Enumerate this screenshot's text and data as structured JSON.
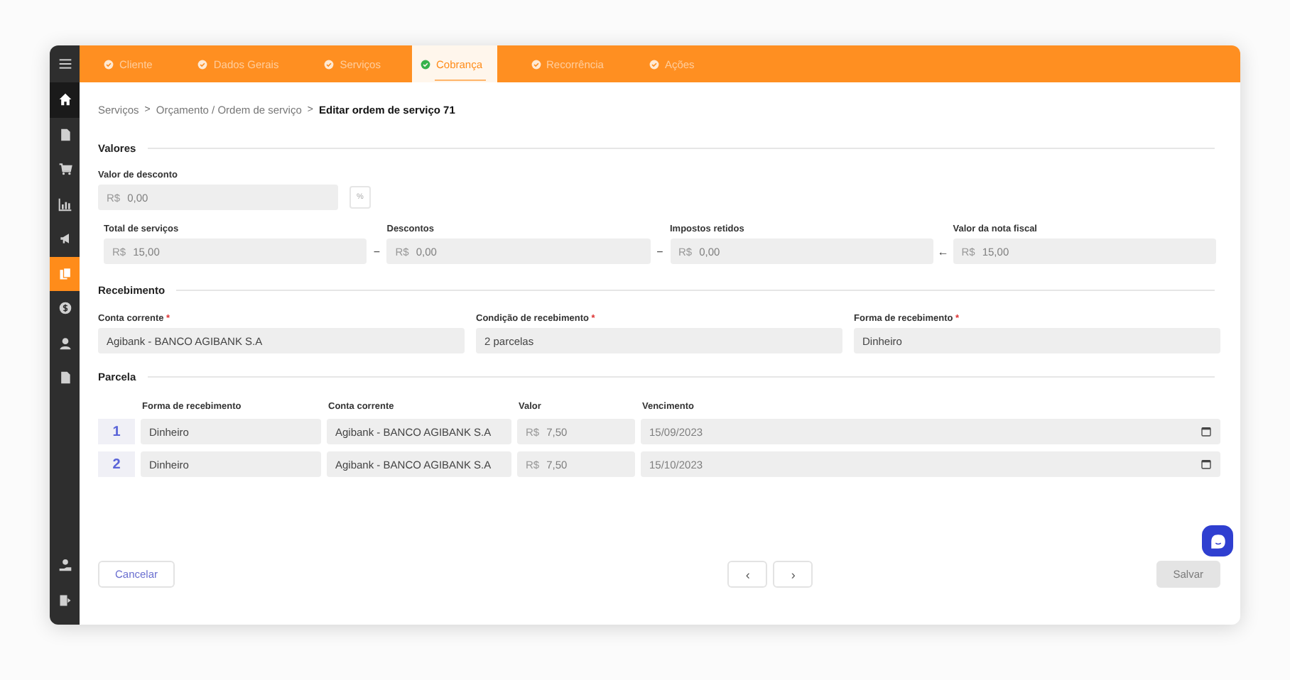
{
  "sidebar": {
    "items": [
      {
        "selected": false,
        "hovered": true
      },
      {
        "selected": false,
        "hovered": false
      },
      {
        "selected": false,
        "hovered": false
      },
      {
        "selected": false,
        "hovered": false
      },
      {
        "selected": false,
        "hovered": false
      },
      {
        "selected": true,
        "hovered": false
      },
      {
        "selected": false,
        "hovered": false
      },
      {
        "selected": false,
        "hovered": false
      },
      {
        "selected": false,
        "hovered": false
      }
    ],
    "bottom_items": [
      {
        "selected": false,
        "hovered": false
      },
      {
        "selected": false,
        "hovered": false
      }
    ]
  },
  "tabs": [
    {
      "label": "Cliente",
      "selected": false
    },
    {
      "label": "Dados Gerais",
      "selected": false
    },
    {
      "label": "Serviços",
      "selected": false
    },
    {
      "label": "Cobrança",
      "selected": true
    },
    {
      "label": "Recorrência",
      "selected": false
    },
    {
      "label": "Ações",
      "selected": false
    }
  ],
  "breadcrumb": [
    {
      "label": "Serviços",
      "current": false
    },
    {
      "label": "Orçamento / Ordem de serviço",
      "current": false
    },
    {
      "label": "Editar ordem de serviço 71",
      "current": true
    }
  ],
  "breadcrumb_separator": ">",
  "valores": {
    "title": "Valores",
    "discount": {
      "label": "Valor de desconto",
      "prefix": "R$",
      "value": "0,00",
      "toggle": "%"
    },
    "totals": [
      {
        "label": "Total de serviços",
        "prefix": "R$",
        "value": "15,00"
      },
      {
        "operator": "−",
        "label": "Descontos",
        "prefix": "R$",
        "value": "0,00"
      },
      {
        "operator": "−",
        "label": "Impostos retidos",
        "prefix": "R$",
        "value": "0,00"
      },
      {
        "operator": "←",
        "label": "Valor da nota fiscal",
        "prefix": "R$",
        "value": "15,00"
      }
    ]
  },
  "recebimento": {
    "title": "Recebimento",
    "fields": [
      {
        "label": "Conta corrente",
        "required_mark": "*",
        "value": "Agibank - BANCO AGIBANK S.A"
      },
      {
        "label": "Condição de recebimento",
        "required_mark": "*",
        "value": "2 parcelas"
      },
      {
        "label": "Forma de recebimento",
        "required_mark": "*",
        "value": "Dinheiro"
      }
    ]
  },
  "parcela": {
    "title": "Parcela",
    "columns": [
      "Forma de recebimento",
      "Conta corrente",
      "Valor",
      "Vencimento"
    ],
    "rows": [
      {
        "number": "1",
        "forma": "Dinheiro",
        "conta": "Agibank - BANCO AGIBANK S.A",
        "prefix": "R$",
        "valor": "7,50",
        "vencimento": "15/09/2023"
      },
      {
        "number": "2",
        "forma": "Dinheiro",
        "conta": "Agibank - BANCO AGIBANK S.A",
        "prefix": "R$",
        "valor": "7,50",
        "vencimento": "15/10/2023"
      }
    ]
  },
  "footer": {
    "cancel": "Cancelar",
    "prev": "‹",
    "next": "›",
    "save": {
      "label": "Salvar",
      "disabled": true
    }
  }
}
